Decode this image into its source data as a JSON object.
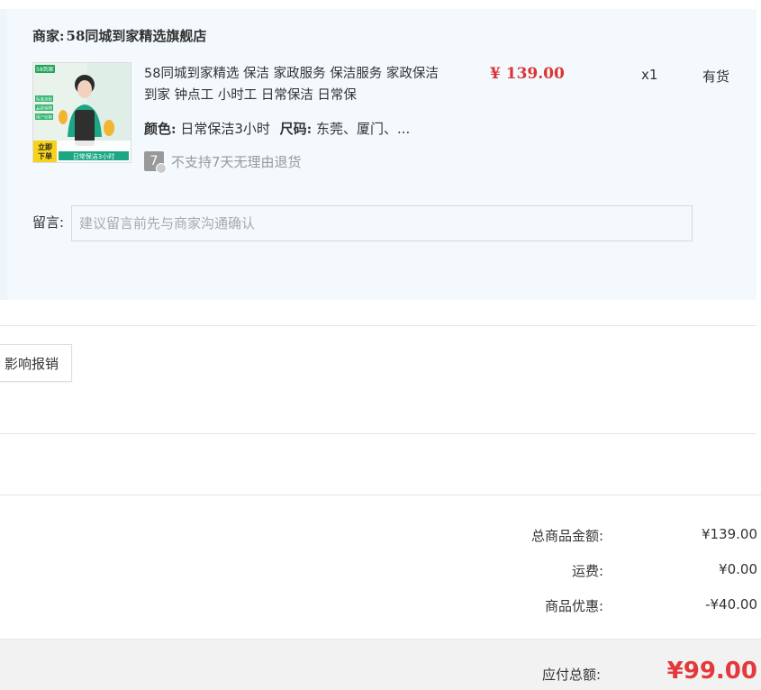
{
  "seller": {
    "label": "商家:",
    "name": "58同城到家精选旗舰店"
  },
  "product": {
    "title": "58同城到家精选 保洁 家政服务 保洁服务 家政保洁 到家 钟点工 小时工 日常保洁 日常保",
    "color_label": "颜色:",
    "color_value": "日常保洁3小时",
    "size_label": "尺码:",
    "size_value": "东莞、厦门、...",
    "return_icon_text": "7",
    "return_policy": "不支持7天无理由退货",
    "price": "¥ 139.00",
    "quantity": "x1",
    "stock": "有货",
    "thumb": {
      "brand": "58到家",
      "badges": [
        "标准流程",
        "品质保障",
        "用户信赖"
      ],
      "corner_text": "立即下单",
      "banner_text": "日常保洁3小时"
    }
  },
  "remark": {
    "label": "留言:",
    "placeholder": "建议留言前先与商家沟通确认",
    "value": ""
  },
  "invoice": {
    "button_label": "影响报销"
  },
  "summary": {
    "items": [
      {
        "label": "总商品金额:",
        "value": "¥139.00"
      },
      {
        "label": "运费:",
        "value": "¥0.00"
      },
      {
        "label": "商品优惠:",
        "value": "-¥40.00"
      }
    ],
    "total_label": "应付总额:",
    "total_value": "¥99.00"
  },
  "colors": {
    "price": "#dd3333",
    "total": "#e4393c",
    "panel_bg": "#f3f9fd"
  }
}
